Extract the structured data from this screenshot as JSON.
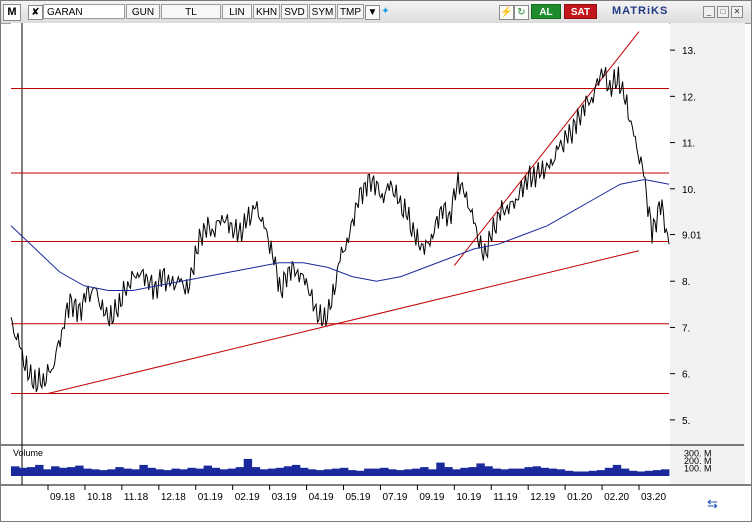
{
  "toolbar": {
    "logo": "M",
    "symbol": "GARAN",
    "period": "GUN",
    "currency": "TL",
    "scale": "LIN",
    "buttons": [
      "KHN",
      "SVD",
      "SYM",
      "TMP"
    ],
    "buy_label": "AL",
    "sell_label": "SAT",
    "brand": "MATRiKS"
  },
  "colors": {
    "price": "#000000",
    "moving_average": "#1a2a9c",
    "support_resistance": "#c00000",
    "volume": "#1a2a9c"
  },
  "chart_data": [
    {
      "type": "line",
      "x_ticks": [
        "09.18",
        "10.18",
        "11.18",
        "12.18",
        "01.19",
        "02.19",
        "03.19",
        "04.19",
        "05.19",
        "07.19",
        "09.19",
        "10.19",
        "11.19",
        "12.19",
        "01.20",
        "02.20",
        "03.20"
      ],
      "y_ticks": [
        5,
        6,
        7,
        8,
        9.01,
        10,
        11,
        12,
        13
      ],
      "y_tick_labels": [
        "5.",
        "6.",
        "7.",
        "8.",
        "9.01",
        "10.",
        "11.",
        "12.",
        "13."
      ],
      "ylim": [
        4.5,
        13.5
      ],
      "horizontal_lines": [
        5.57,
        7.08,
        8.86,
        10.34,
        12.17
      ],
      "trend_lines": [
        {
          "from": [
            "09.18",
            5.57
          ],
          "to": [
            "03.20",
            8.66
          ]
        },
        {
          "from": [
            "10.19",
            8.34
          ],
          "to": [
            "03.20",
            13.4
          ]
        }
      ],
      "series": [
        {
          "values": [
            7.1,
            6.6,
            6.0,
            5.8,
            5.9,
            6.2,
            6.9,
            7.6,
            7.3,
            7.7,
            7.8,
            7.3,
            7.2,
            7.6,
            8.0,
            8.2,
            8.1,
            7.8,
            8.1,
            7.9,
            8.0,
            7.8,
            8.7,
            9.2,
            9.1,
            9.4,
            9.2,
            9.0,
            9.3,
            9.6,
            9.2,
            8.6,
            7.8,
            8.3,
            8.2,
            8.0,
            7.4,
            7.1,
            7.5,
            8.5,
            8.9,
            9.7,
            10.1,
            10.2,
            9.8,
            10.1,
            9.7,
            9.4,
            8.9,
            8.7,
            9.0,
            9.6,
            9.4,
            10.2,
            9.8,
            9.2,
            8.5,
            9.0,
            9.5,
            9.6,
            9.8,
            10.2,
            10.3,
            10.4,
            10.5,
            10.9,
            11.1,
            11.4,
            11.8,
            12.0,
            12.6,
            12.2,
            12.4,
            11.8,
            11.0,
            10.3,
            9.0,
            9.7,
            8.8
          ]
        },
        {
          "values": [
            9.2,
            8.7,
            8.2,
            7.9,
            7.8,
            7.8,
            7.9,
            8.0,
            8.1,
            8.2,
            8.3,
            8.4,
            8.4,
            8.3,
            8.1,
            8.0,
            8.1,
            8.3,
            8.5,
            8.7,
            8.8,
            9.0,
            9.2,
            9.5,
            9.8,
            10.1,
            10.2,
            10.1
          ]
        }
      ]
    },
    {
      "type": "bar",
      "label": "Volume",
      "y_tick_labels": [
        "300. M",
        "200. M",
        "100. M"
      ],
      "y_ticks": [
        300,
        200,
        100
      ],
      "ylim": [
        0,
        350
      ],
      "series": [
        {
          "values": [
            130,
            110,
            120,
            150,
            90,
            130,
            110,
            120,
            140,
            100,
            90,
            80,
            90,
            120,
            100,
            90,
            150,
            110,
            90,
            80,
            100,
            90,
            110,
            100,
            140,
            110,
            90,
            100,
            120,
            230,
            120,
            90,
            100,
            110,
            130,
            150,
            110,
            90,
            80,
            90,
            100,
            110,
            80,
            70,
            100,
            100,
            110,
            90,
            80,
            90,
            100,
            120,
            90,
            180,
            120,
            90,
            110,
            120,
            170,
            130,
            100,
            90,
            100,
            100,
            120,
            130,
            110,
            100,
            90,
            70,
            60,
            60,
            70,
            80,
            110,
            150,
            100,
            70,
            60,
            70,
            80,
            90
          ]
        }
      ]
    }
  ]
}
